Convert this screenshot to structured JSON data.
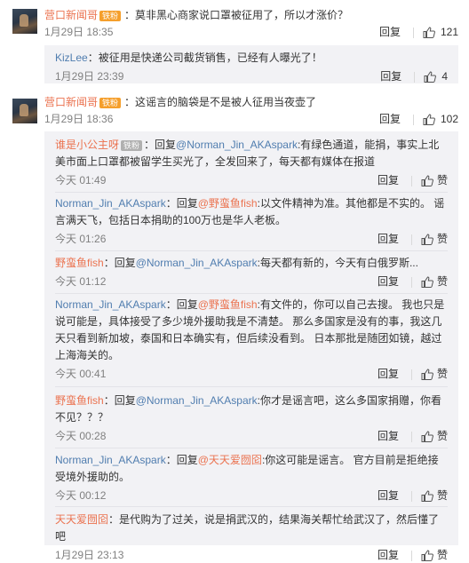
{
  "comment1": {
    "user": "营口新闻哥",
    "badge": "铁粉",
    "text": "：莫非黑心商家说口罩被征用了，所以才涨价？",
    "time": "1月29日 18:35",
    "reply_label": "回复",
    "likes": "121",
    "reply": {
      "user": "KizLee",
      "text": "：被征用是快递公司截货销售，已经有人曝光了！",
      "time": "1月29日 23:39",
      "reply_label": "回复",
      "likes": "4"
    }
  },
  "comment2": {
    "user": "营口新闻哥",
    "badge": "铁粉",
    "text": "：这谣言的脑袋是不是被人征用当夜壶了",
    "time": "1月29日 18:36",
    "reply_label": "回复",
    "likes": "102",
    "replies": [
      {
        "user": "谁是小公主呀",
        "badge": "铁粉",
        "prefix": "：回复",
        "to": "@Norman_Jin_AKAspark",
        "text": ":有绿色通道，能捐，事实上北美市面上口罩都被留学生买光了，全发回来了，每天都有媒体在报道",
        "time": "今天 01:49",
        "reply_label": "回复",
        "like_label": "赞"
      },
      {
        "user": "Norman_Jin_AKAspark",
        "prefix": "：回复",
        "to": "@野蛮鱼fish",
        "text": ":以文件精神为准。其他都是不实的。 谣言满天飞，包括日本捐助的100万也是华人老板。",
        "time": "今天 01:26",
        "reply_label": "回复",
        "like_label": "赞"
      },
      {
        "user": "野蛮鱼fish",
        "prefix": "：回复",
        "to": "@Norman_Jin_AKAspark",
        "text": ":每天都有新的，今天有白俄罗斯...",
        "time": "今天 01:12",
        "reply_label": "回复",
        "like_label": "赞"
      },
      {
        "user": "Norman_Jin_AKAspark",
        "prefix": "：回复",
        "to": "@野蛮鱼fish",
        "text": ":有文件的，你可以自己去搜。 我也只是说可能是，具体接受了多少境外援助我是不清楚。 那么多国家是没有的事，我这几天只看到新加坡，泰国和日本确实有，但后续没看到。 日本那批是随团如镜，越过上海海关的。",
        "time": "今天 00:41",
        "reply_label": "回复",
        "like_label": "赞"
      },
      {
        "user": "野蛮鱼fish",
        "prefix": "：回复",
        "to": "@Norman_Jin_AKAspark",
        "text": ":你才是谣言吧，这么多国家捐赠，你看不见？？？",
        "time": "今天 00:28",
        "reply_label": "回复",
        "like_label": "赞"
      },
      {
        "user": "Norman_Jin_AKAspark",
        "prefix": "：回复",
        "to": "@天天爱囫囵",
        "text": ":你这可能是谣言。 官方目前是拒绝接受境外援助的。",
        "time": "今天 00:12",
        "reply_label": "回复",
        "like_label": "赞"
      },
      {
        "user": "天天爱囫囵",
        "prefix": "",
        "to": "",
        "text": "：是代购为了过关，说是捐武汉的，结果海关帮忙给武汉了，然后懂了吧",
        "time": "1月29日 23:13",
        "reply_label": "回复",
        "like_label": "赞"
      }
    ]
  },
  "colors": {
    "link": "#eb7350",
    "reply_bg": "#f2f2f5",
    "badge": "#f59f2c"
  },
  "icons": {
    "like": "thumbs-up-icon",
    "vip": "vip-badge-icon"
  }
}
